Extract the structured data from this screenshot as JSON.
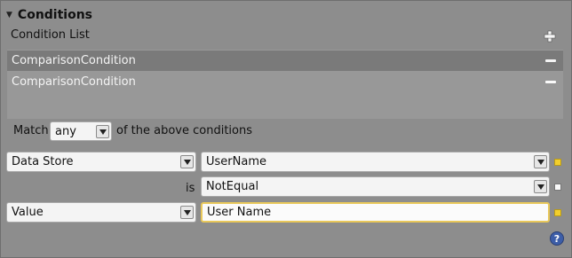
{
  "panel": {
    "title": "Conditions",
    "collapse_icon": "triangle-down-icon",
    "list_label": "Condition List",
    "add_icon": "plus-icon"
  },
  "conditions": [
    {
      "label": "ComparisonCondition",
      "selected": true,
      "remove_icon": "minus-icon"
    },
    {
      "label": "ComparisonCondition",
      "selected": false,
      "remove_icon": "minus-icon"
    }
  ],
  "match": {
    "prefix": "Match",
    "value": "any",
    "suffix": "of the above conditions"
  },
  "expression": {
    "left_source": "Data Store",
    "left_value": "UserName",
    "operator_label": "is",
    "operator": "NotEqual",
    "right_source": "Value",
    "right_value": "User Name"
  },
  "colors": {
    "panel_bg": "#8d8d8d",
    "list_bg": "#989898",
    "selected_row": "#7a7a7a",
    "accent_yellow": "#f2cf2c",
    "help_blue": "#3d5ea8"
  },
  "help_icon": "question-icon"
}
